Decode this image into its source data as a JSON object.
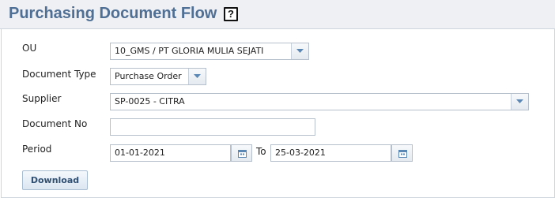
{
  "page": {
    "title": "Purchasing Document Flow",
    "help_icon": "help-icon",
    "help_glyph": "?"
  },
  "form": {
    "ou": {
      "label": "OU",
      "value": "10_GMS / PT GLORIA MULIA SEJATI"
    },
    "document_type": {
      "label": "Document Type",
      "value": "Purchase Order"
    },
    "supplier": {
      "label": "Supplier",
      "value": "SP-0025 - CITRA"
    },
    "document_no": {
      "label": "Document No",
      "value": ""
    },
    "period": {
      "label": "Period",
      "from": "01-01-2021",
      "to_label": "To",
      "to": "25-03-2021"
    }
  },
  "actions": {
    "download_label": "Download"
  },
  "colors": {
    "title": "#4f6f95",
    "button_text": "#2f4f73",
    "calendar_icon": "#5b87b5"
  }
}
